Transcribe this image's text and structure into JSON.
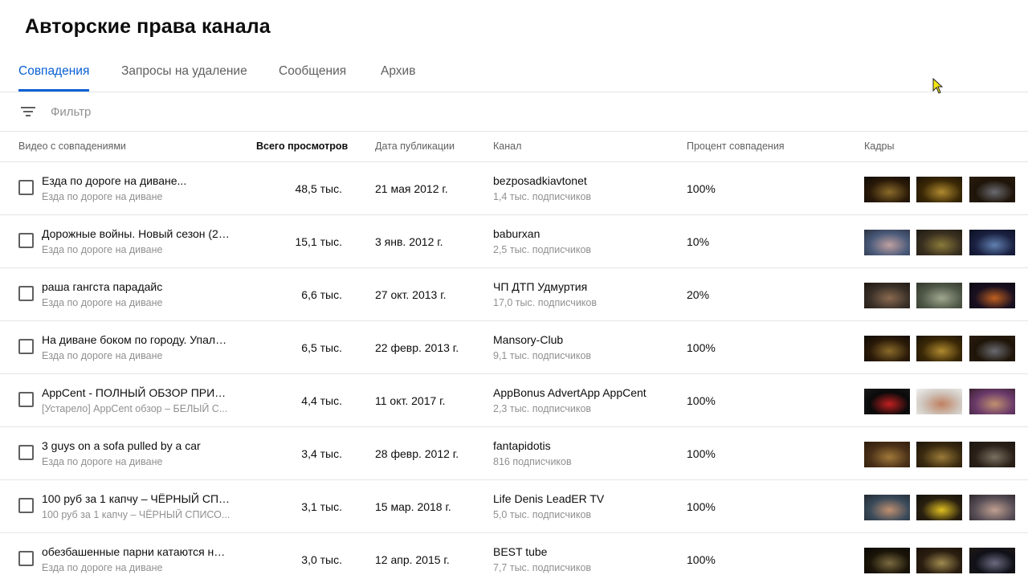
{
  "page": {
    "title": "Авторские права канала"
  },
  "tabs": [
    {
      "label": "Совпадения",
      "active": true
    },
    {
      "label": "Запросы на удаление",
      "active": false
    },
    {
      "label": "Сообщения",
      "active": false
    },
    {
      "label": "Архив",
      "active": false
    }
  ],
  "filter": {
    "placeholder": "Фильтр",
    "icon": "filter-icon"
  },
  "table": {
    "headers": {
      "video": "Видео с совпадениями",
      "views": "Всего просмотров",
      "date": "Дата публикации",
      "channel": "Канал",
      "percent": "Процент совпадения",
      "frames": "Кадры"
    },
    "rows": [
      {
        "title": "Езда по дороге на диване...",
        "subtitle": "Езда по дороге на диване",
        "views": "48,5 тыс.",
        "date": "21 мая 2012 г.",
        "channel": "bezposadkiavtonet",
        "subscribers": "1,4 тыс. подписчиков",
        "percent": "100%",
        "frames": [
          [
            "#2a1a08",
            "#8a6a2a",
            "#0d0905"
          ],
          [
            "#3a2806",
            "#b08a30",
            "#1a1206"
          ],
          [
            "#1e1408",
            "#6a6a70",
            "#2a1e10"
          ]
        ]
      },
      {
        "title": "Дорожные войны. Новый сезон (26...",
        "subtitle": "Езда по дороге на диване",
        "views": "15,1 тыс.",
        "date": "3 янв. 2012 г.",
        "channel": "baburxan",
        "subscribers": "2,5 тыс. подписчиков",
        "percent": "10%",
        "frames": [
          [
            "#4a5a7a",
            "#c0a0a0",
            "#2a3040"
          ],
          [
            "#3a3020",
            "#8a7a3a",
            "#1a1810"
          ],
          [
            "#1a2040",
            "#6080b0",
            "#0a1020"
          ]
        ]
      },
      {
        "title": "раша гангста парадайс",
        "subtitle": "Езда по дороге на диване",
        "views": "6,6 тыс.",
        "date": "27 окт. 2013 г.",
        "channel": "ЧП ДТП Удмуртия",
        "subscribers": "17,0 тыс. подписчиков",
        "percent": "20%",
        "frames": [
          [
            "#3a3028",
            "#8a6a50",
            "#1a1410"
          ],
          [
            "#505848",
            "#a0a890",
            "#30362a"
          ],
          [
            "#1a1020",
            "#c06020",
            "#0a0810"
          ]
        ]
      },
      {
        "title": "На диване боком по городу. Упали ...",
        "subtitle": "Езда по дороге на диване",
        "views": "6,5 тыс.",
        "date": "22 февр. 2013 г.",
        "channel": "Mansory-Club",
        "subscribers": "9,1 тыс. подписчиков",
        "percent": "100%",
        "frames": [
          [
            "#2a1a08",
            "#8a6a2a",
            "#0d0905"
          ],
          [
            "#3a2806",
            "#b08a30",
            "#1a1206"
          ],
          [
            "#1e1408",
            "#6a6a70",
            "#2a1e10"
          ]
        ]
      },
      {
        "title": "AppCent - ПОЛНЫЙ ОБЗОР ПРИЛО...",
        "subtitle": "[Устарело] AppCent обзор – БЕЛЫЙ С...",
        "views": "4,4 тыс.",
        "date": "11 окт. 2017 г.",
        "channel": "AppBonus AdvertApp AppCent",
        "subscribers": "2,3 тыс. подписчиков",
        "percent": "100%",
        "frames": [
          [
            "#0a0a0a",
            "#c02020",
            "#1a1a1a"
          ],
          [
            "#d0c8c0",
            "#c08060",
            "#f0f0f0"
          ],
          [
            "#6a3a6a",
            "#c09070",
            "#3a2030"
          ]
        ]
      },
      {
        "title": "3 guys on a sofa pulled by a car",
        "subtitle": "Езда по дороге на диване",
        "views": "3,4 тыс.",
        "date": "28 февр. 2012 г.",
        "channel": "fantapidotis",
        "subscribers": "816 подписчиков",
        "percent": "100%",
        "frames": [
          [
            "#4a3018",
            "#a07838",
            "#2a1a0a"
          ],
          [
            "#3a2a10",
            "#9a7a38",
            "#1a1208"
          ],
          [
            "#2a2018",
            "#7a7060",
            "#1a1410"
          ]
        ]
      },
      {
        "title": "100 руб за 1 капчу – ЧЁРНЫЙ СПИС...",
        "subtitle": "100 руб за 1 капчу – ЧЁРНЫЙ СПИСО...",
        "views": "3,1 тыс.",
        "date": "15 мар. 2018 г.",
        "channel": "Life Denis LeadER TV",
        "subscribers": "5,0 тыс. подписчиков",
        "percent": "100%",
        "frames": [
          [
            "#3a4a5a",
            "#c09070",
            "#202830"
          ],
          [
            "#2a2010",
            "#e0c020",
            "#101008"
          ],
          [
            "#5a5058",
            "#c0a090",
            "#2a2428"
          ]
        ]
      },
      {
        "title": "обезбашенные парни катаются на ...",
        "subtitle": "Езда по дороге на диване",
        "views": "3,0 тыс.",
        "date": "12 апр. 2015 г.",
        "channel": "BEST tube",
        "subscribers": "7,7 тыс. подписчиков",
        "percent": "100%",
        "frames": [
          [
            "#1a1408",
            "#7a6a40",
            "#0a0804"
          ],
          [
            "#2a1e10",
            "#a08a50",
            "#1a1008"
          ],
          [
            "#101018",
            "#6a6a80",
            "#201a14"
          ]
        ]
      }
    ]
  }
}
